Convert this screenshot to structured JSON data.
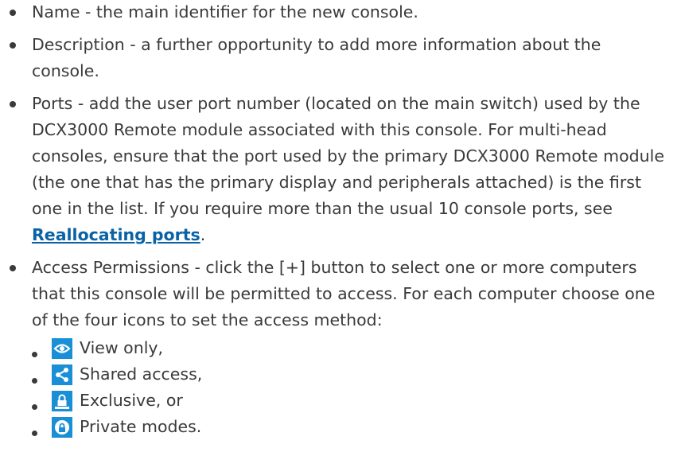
{
  "bullets": {
    "name_text": "Name - the main identifier for the new console.",
    "description_text": "Description - a further opportunity to add more information about the console.",
    "ports_text_before_link": "Ports - add the user port number (located on the main switch) used by the DCX3000 Remote module associated with this console. For multi-head consoles, ensure that the port used by the primary DCX3000 Remote module (the one that has the primary display and peripherals attached) is the first one in the list. If you require more than the usual 10 console ports, see ",
    "ports_link_text": "Reallocating ports",
    "ports_text_after_link": ".",
    "access_text": "Access Permissions - click the [+] button to select one or more computers that this console will be permitted to access. For each computer choose one of the four icons to set the access method:"
  },
  "access_modes": [
    {
      "icon": "eye-icon",
      "label": "View only,"
    },
    {
      "icon": "share-icon",
      "label": "Shared access,"
    },
    {
      "icon": "exclusive-lock-icon",
      "label": "Exclusive, or"
    },
    {
      "icon": "private-lock-icon",
      "label": "Private modes."
    }
  ],
  "colors": {
    "text": "#3a3a3a",
    "link": "#0a62a6",
    "icon_bg": "#1a8fd6"
  }
}
